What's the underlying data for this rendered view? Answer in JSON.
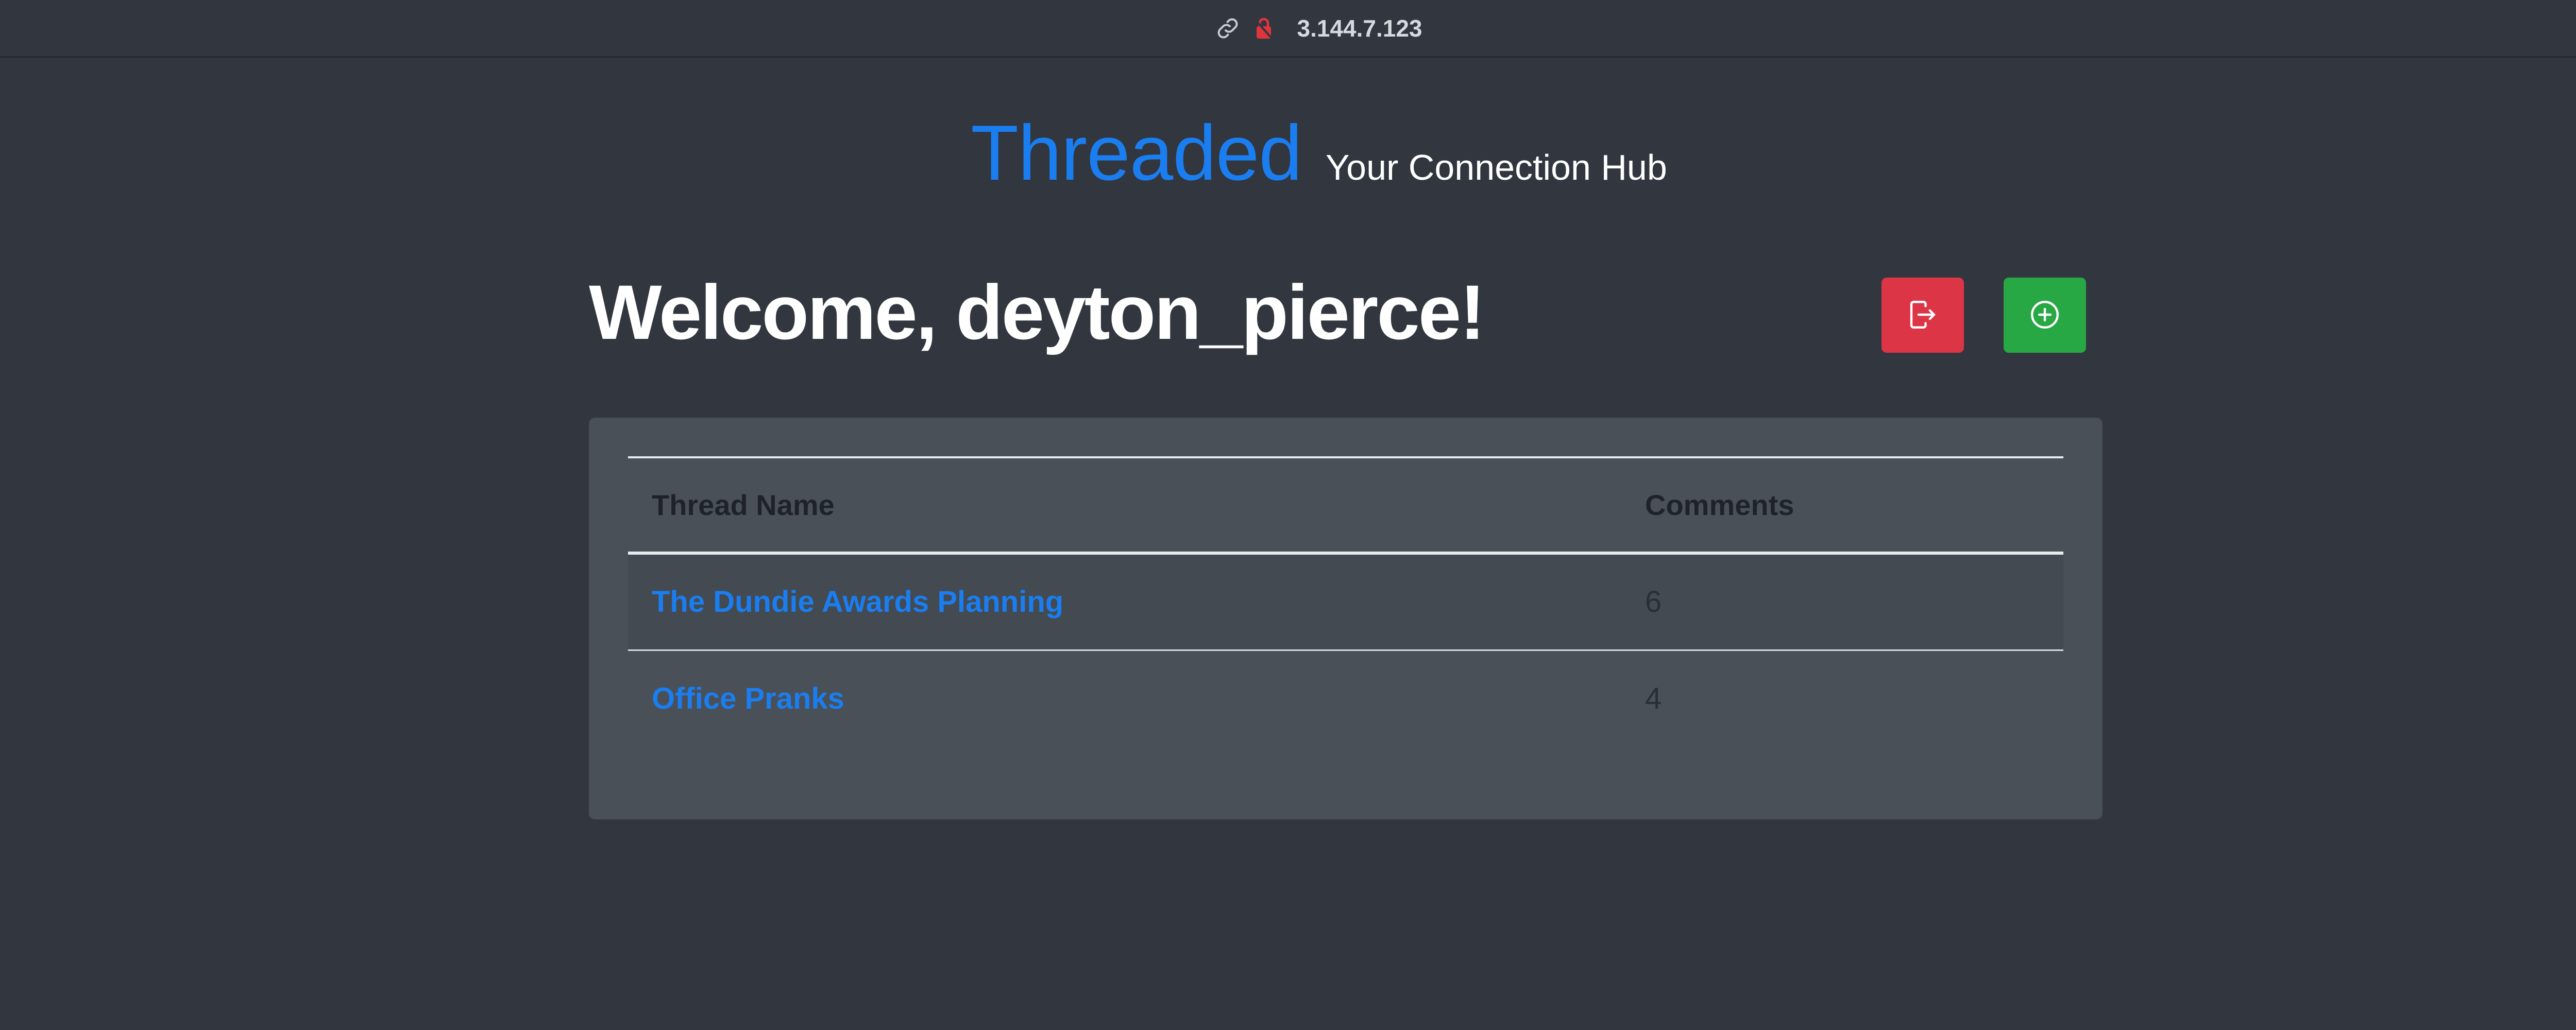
{
  "browser": {
    "url": "3.144.7.123",
    "icons": [
      "link-icon",
      "lock-icon"
    ]
  },
  "brand": {
    "logo": "Threaded",
    "tagline": "Your Connection Hub"
  },
  "header": {
    "welcome": "Welcome, deyton_pierce!",
    "buttons": [
      {
        "name": "logout-button",
        "icon": "logout-icon",
        "color": "#dc3545"
      },
      {
        "name": "new-thread-button",
        "icon": "plus-circle-icon",
        "color": "#28a745"
      }
    ]
  },
  "threads": {
    "columns": [
      "Thread Name",
      "Comments"
    ],
    "rows": [
      {
        "name": "The Dundie Awards Planning",
        "comments": "6"
      },
      {
        "name": "Office Pranks",
        "comments": "4"
      }
    ]
  },
  "colors": {
    "background": "#31363f",
    "card": "#495058",
    "accent": "#1a7ef0"
  }
}
